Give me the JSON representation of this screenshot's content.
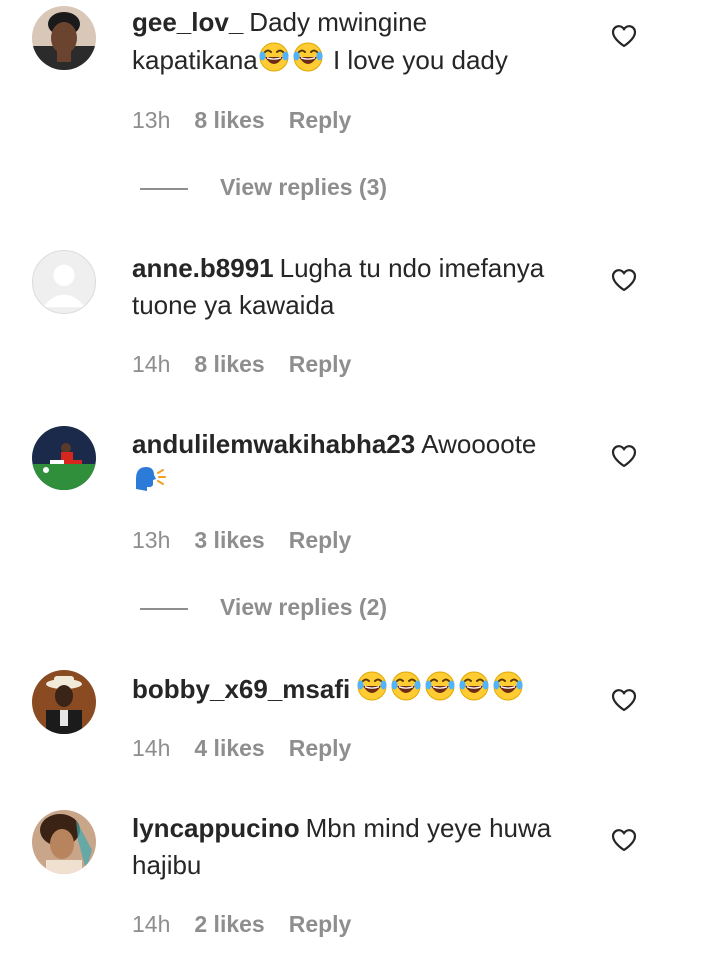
{
  "comments": [
    {
      "username": "gee_lov_",
      "text": "Dady mwingine kapatikana😂😂 I love you dady",
      "text_part1": "Dady mwingine",
      "text_part2": "kapatikana",
      "text_part3": " I love you dady",
      "time": "13h",
      "likes": "8 likes",
      "reply": "Reply",
      "view_replies": "View replies (3)",
      "avatar_icon": "profile-photo-woman"
    },
    {
      "username": "anne.b8991",
      "text": "Lugha tu ndo imefanya tuone ya kawaida",
      "text_part1": "Lugha tu ndo imefanya",
      "text_part2": "tuone ya kawaida",
      "time": "14h",
      "likes": "8 likes",
      "reply": "Reply",
      "avatar_icon": "default-profile-icon"
    },
    {
      "username": "andulilemwakihabha23",
      "text": "Awoooote 🗣️",
      "text_part1": "Awoooote",
      "time": "13h",
      "likes": "3 likes",
      "reply": "Reply",
      "view_replies": "View replies (2)",
      "avatar_icon": "football-player-photo",
      "emoji_icon": "speaking-head-emoji"
    },
    {
      "username": "bobby_x69_msafi",
      "text": "😂😂😂😂😂",
      "time": "14h",
      "likes": "4 likes",
      "reply": "Reply",
      "avatar_icon": "man-in-hat-photo",
      "emoji_icon": "tears-of-joy-emoji"
    },
    {
      "username": "lyncappucino",
      "text": "Mbn mind yeye huwa hajibu",
      "text_part1": "Mbn mind yeye huwa",
      "text_part2": "hajibu",
      "time": "14h",
      "likes": "2 likes",
      "reply": "Reply",
      "avatar_icon": "profile-photo-woman"
    }
  ],
  "icons": {
    "like": "heart-outline-icon"
  },
  "colors": {
    "text": "#262626",
    "secondary": "#8e8e8e",
    "background": "#ffffff"
  }
}
